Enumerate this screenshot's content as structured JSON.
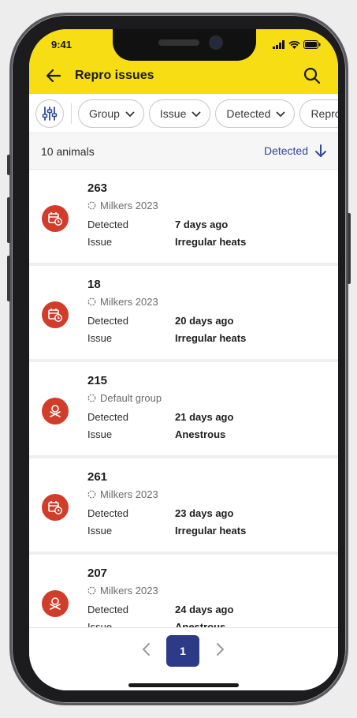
{
  "status_bar": {
    "time": "9:41"
  },
  "header": {
    "title": "Repro issues",
    "back_icon": "arrow-left-icon",
    "search_icon": "search-icon"
  },
  "filters": {
    "chips": [
      {
        "label": "Group"
      },
      {
        "label": "Issue"
      },
      {
        "label": "Detected"
      },
      {
        "label": "Repro"
      }
    ]
  },
  "summary": {
    "count": "10 animals",
    "sort_label": "Detected",
    "sort_icon": "arrow-down-icon"
  },
  "labels": {
    "detected": "Detected",
    "issue": "Issue"
  },
  "animals": [
    {
      "id": "263",
      "group": "Milkers 2023",
      "detected": "7 days ago",
      "issue": "Irregular heats",
      "icon": "calendar-clock-icon"
    },
    {
      "id": "18",
      "group": "Milkers 2023",
      "detected": "20 days ago",
      "issue": "Irregular heats",
      "icon": "calendar-clock-icon"
    },
    {
      "id": "215",
      "group": "Default group",
      "detected": "21 days ago",
      "issue": "Anestrous",
      "icon": "anestrous-icon"
    },
    {
      "id": "261",
      "group": "Milkers 2023",
      "detected": "23 days ago",
      "issue": "Irregular heats",
      "icon": "calendar-clock-icon"
    },
    {
      "id": "207",
      "group": "Milkers 2023",
      "detected": "24 days ago",
      "issue": "Anestrous",
      "icon": "anestrous-icon"
    }
  ],
  "pagination": {
    "current": "1"
  },
  "colors": {
    "header": "#f7dd14",
    "accent": "#2c3a87",
    "link": "#2f4a9a",
    "issue_badge": "#d23c2a"
  }
}
